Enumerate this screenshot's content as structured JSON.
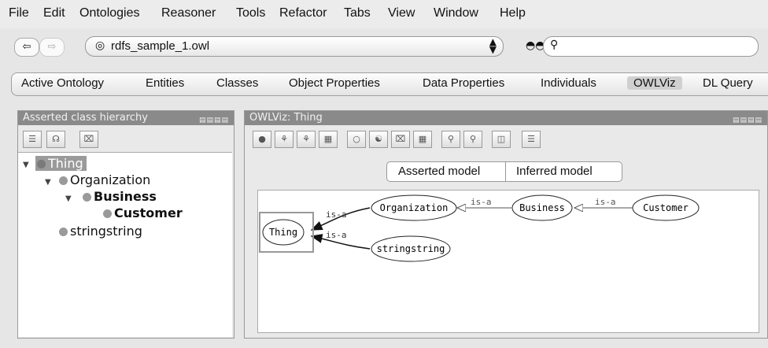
{
  "menu": [
    "File",
    "Edit",
    "Ontologies",
    "Reasoner",
    "Tools",
    "Refactor",
    "Tabs",
    "View",
    "Window",
    "Help"
  ],
  "toolbar": {
    "ontology": "rdfs_sample_1.owl",
    "search_value": ""
  },
  "tabs": [
    "Active Ontology",
    "Entities",
    "Classes",
    "Object Properties",
    "Data Properties",
    "Individuals",
    "OWLViz",
    "DL Query"
  ],
  "active_tab": "OWLViz",
  "left_panel": {
    "title": "Asserted class hierarchy",
    "tree": [
      {
        "label": "Thing",
        "level": 0,
        "selected": true,
        "expanded": true
      },
      {
        "label": "Organization",
        "level": 1,
        "expanded": true
      },
      {
        "label": "Business",
        "level": 2,
        "bold": true,
        "expanded": true
      },
      {
        "label": "Customer",
        "level": 3,
        "bold": true
      },
      {
        "label": "stringstring",
        "level": 1
      }
    ]
  },
  "right_panel": {
    "title": "OWLViz: Thing",
    "model_tabs": [
      "Asserted model",
      "Inferred model"
    ],
    "graph": {
      "nodes": [
        "Thing",
        "Organization",
        "Business",
        "Customer",
        "stringstring"
      ],
      "edges": [
        {
          "from": "Organization",
          "to": "Thing",
          "label": "is-a"
        },
        {
          "from": "stringstring",
          "to": "Thing",
          "label": "is-a"
        },
        {
          "from": "Business",
          "to": "Organization",
          "label": "is-a"
        },
        {
          "from": "Customer",
          "to": "Business",
          "label": "is-a"
        }
      ]
    }
  },
  "colors": {
    "panel_header": "#8a8a8a",
    "selection": "#9a9a9a",
    "class_dot": "#9a9a9a"
  },
  "icons": [
    "back-arrow-icon",
    "forward-arrow-icon",
    "ontology-icon",
    "binoculars-icon",
    "search-icon"
  ]
}
